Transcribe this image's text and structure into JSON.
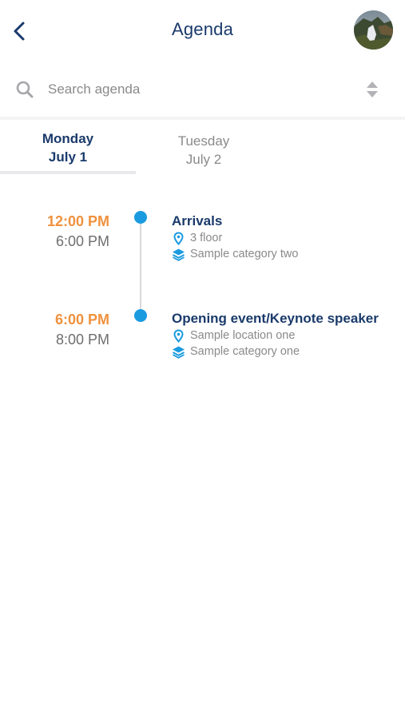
{
  "header": {
    "title": "Agenda"
  },
  "search": {
    "placeholder": "Search agenda",
    "value": ""
  },
  "tabs": [
    {
      "day": "Monday",
      "date": "July 1",
      "active": true
    },
    {
      "day": "Tuesday",
      "date": "July 2",
      "active": false
    }
  ],
  "events": [
    {
      "start": "12:00 PM",
      "end": "6:00 PM",
      "title": "Arrivals",
      "location": "3 floor",
      "category": "Sample category two"
    },
    {
      "start": "6:00 PM",
      "end": "8:00 PM",
      "title": "Opening event/Keynote speaker",
      "location": "Sample location one",
      "category": "Sample category one"
    }
  ],
  "colors": {
    "title_navy": "#1a3a6b",
    "time_orange": "#f0913d",
    "timeline_blue": "#1a9be0",
    "muted_gray": "#8a8a8a"
  },
  "icons": [
    "back-chevron-icon",
    "avatar-photo",
    "search-icon",
    "sort-icon",
    "location-pin-icon",
    "category-layers-icon"
  ]
}
